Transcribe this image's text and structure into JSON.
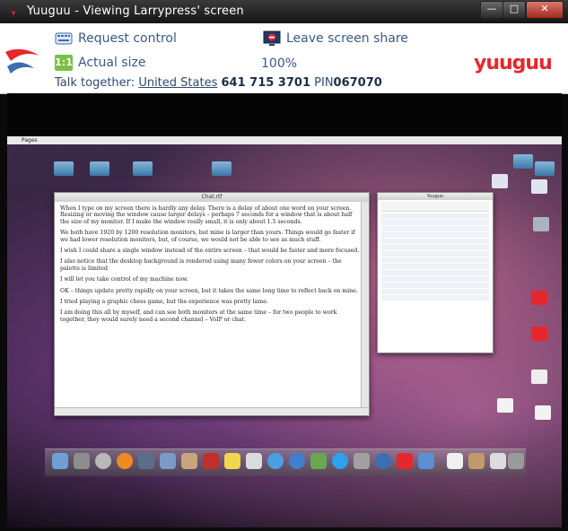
{
  "window": {
    "title": "Yuuguu - Viewing Larrypress' screen",
    "controls": {
      "minimize": "—",
      "maximize": "□",
      "close": "✕"
    }
  },
  "toolbar": {
    "request_control": "Request control",
    "leave_share": "Leave screen share",
    "actual_size_badge": "1:1",
    "actual_size": "Actual size",
    "zoom": "100%",
    "talk_prefix": "Talk together:",
    "talk_country": "United States",
    "talk_number": "641 715 3701",
    "pin_label": "PIN",
    "pin": "067070",
    "logo": "yuuguu"
  },
  "remote": {
    "menubar_app": "Pages",
    "doc_title": "Chat.rtf",
    "panel_title": "Yuuguu",
    "paragraphs": [
      "When I type on my screen there is hardly any delay. There is a delay of about one word on your screen. Resizing or moving the window cause larger delays – perhaps 7 seconds for a window that is about half the size of my monitor. If I make the window really small, it is only about 1.5 seconds.",
      "We both have 1920 by 1200 resolution monitors, but mine is larger than yours. Things would go faster if we had lower resolution monitors, but, of course, we would not be able to see as much stuff.",
      "I wish I could share a single window instead of the entire screen – that would be faster and more focused.",
      "I also notice that the desktop background is rendered using many fewer colors on your screen – the palette is limited",
      "I will let you take control of my machine now.",
      "OK – things update pretty rapidly on your screen, but it takes the same long time to reflect back on mine.",
      "I tried playing a graphic chess game, but the experience was pretty lame.",
      "I am doing this all by myself, and can see both monitors at the same time – for two people to work together, they would surely need a second channel – VoIP or chat."
    ]
  },
  "colors": {
    "accent_text": "#3a5a85",
    "brand_red": "#e8262d",
    "actual_size_green": "#7ac143"
  }
}
